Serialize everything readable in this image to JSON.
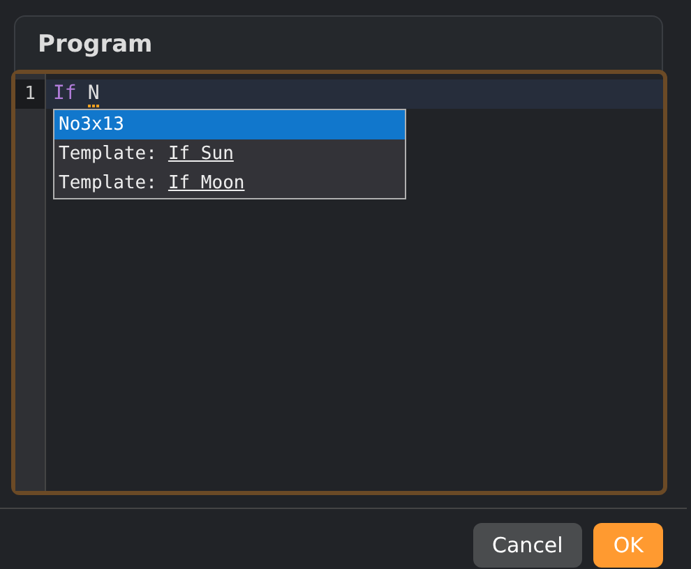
{
  "dialog": {
    "title": "Program"
  },
  "editor": {
    "lines": [
      {
        "number": "1",
        "keyword": "If",
        "text": "N",
        "current": true
      }
    ]
  },
  "autocomplete": [
    {
      "label": "No3x13",
      "selected": true
    },
    {
      "label": "Template:",
      "detail": "If Sun",
      "selected": false
    },
    {
      "label": "Template:",
      "detail": "If Moon",
      "selected": false
    }
  ],
  "buttons": [
    {
      "label": "Cancel",
      "kind": "secondary"
    },
    {
      "label": "OK",
      "kind": "primary"
    }
  ]
}
